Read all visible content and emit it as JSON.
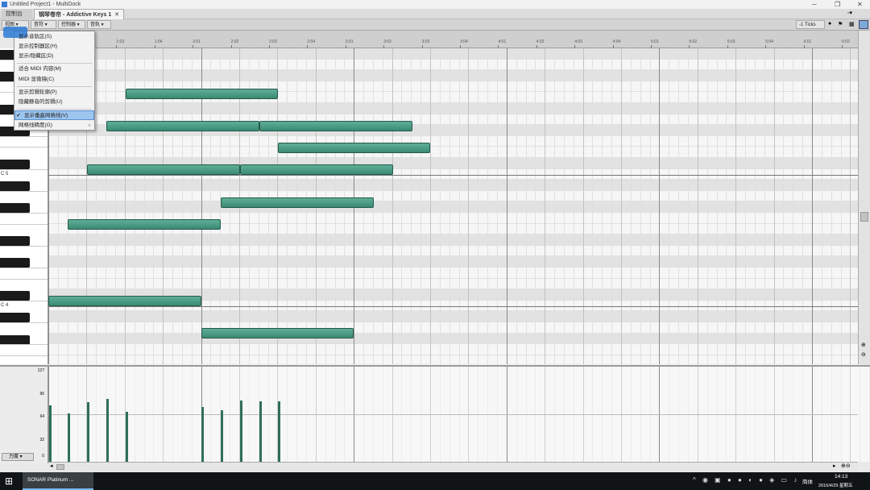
{
  "window": {
    "title": "Untitled Project1 - MultiDock"
  },
  "tabs": [
    {
      "label": "控制台"
    },
    {
      "label": "钢琴卷帘 - Addictive Keys 1"
    }
  ],
  "toolbar": {
    "items": [
      "视图",
      "音符",
      "控制器",
      "音轨"
    ],
    "snap": "-1 Ticks"
  },
  "ruler": {
    "ticks": [
      "1:02",
      "1:03",
      "1:04",
      "2:01",
      "2:02",
      "2:03",
      "2:04",
      "3:01",
      "3:02",
      "3:03",
      "3:04",
      "4:01",
      "4:02",
      "4:03",
      "4:04",
      "5:01",
      "5:02",
      "5:03",
      "5:04",
      "6:01",
      "6:02"
    ]
  },
  "keys": {
    "c5_label": "C 5",
    "c4_label": "C 4"
  },
  "view_menu": {
    "items": [
      {
        "label": "显示音轨区(S)",
        "checked": false,
        "highlighted": false
      },
      {
        "label": "显示控制器区(H)",
        "checked": false,
        "highlighted": false
      },
      {
        "label": "显示/隐藏区(D)",
        "checked": false,
        "highlighted": false
      },
      {
        "label": "适合 MIDI 内容(M)",
        "checked": false,
        "highlighted": false
      },
      {
        "label": "MIDI 显微镜(C)",
        "checked": false,
        "highlighted": false
      },
      {
        "label": "显示剪辑轮廓(P)",
        "checked": false,
        "highlighted": false
      },
      {
        "label": "隐藏静音的剪辑(U)",
        "checked": false,
        "highlighted": false
      },
      {
        "label": "显示垂直网格线(V)",
        "checked": true,
        "highlighted": true
      },
      {
        "label": "网格线精度(G)",
        "checked": false,
        "highlighted": false,
        "submenu": true
      }
    ]
  },
  "velocity": {
    "y_labels": [
      "127",
      "96",
      "64",
      "32",
      "0"
    ],
    "control_label": "力度"
  },
  "taskbar": {
    "app": "SONAR Platinum ...",
    "ime": "简体",
    "time": "14:13",
    "date": "2016/4/29 星期五"
  },
  "colors": {
    "note": "#4a9a82",
    "highlight": "#9cc5ef"
  }
}
